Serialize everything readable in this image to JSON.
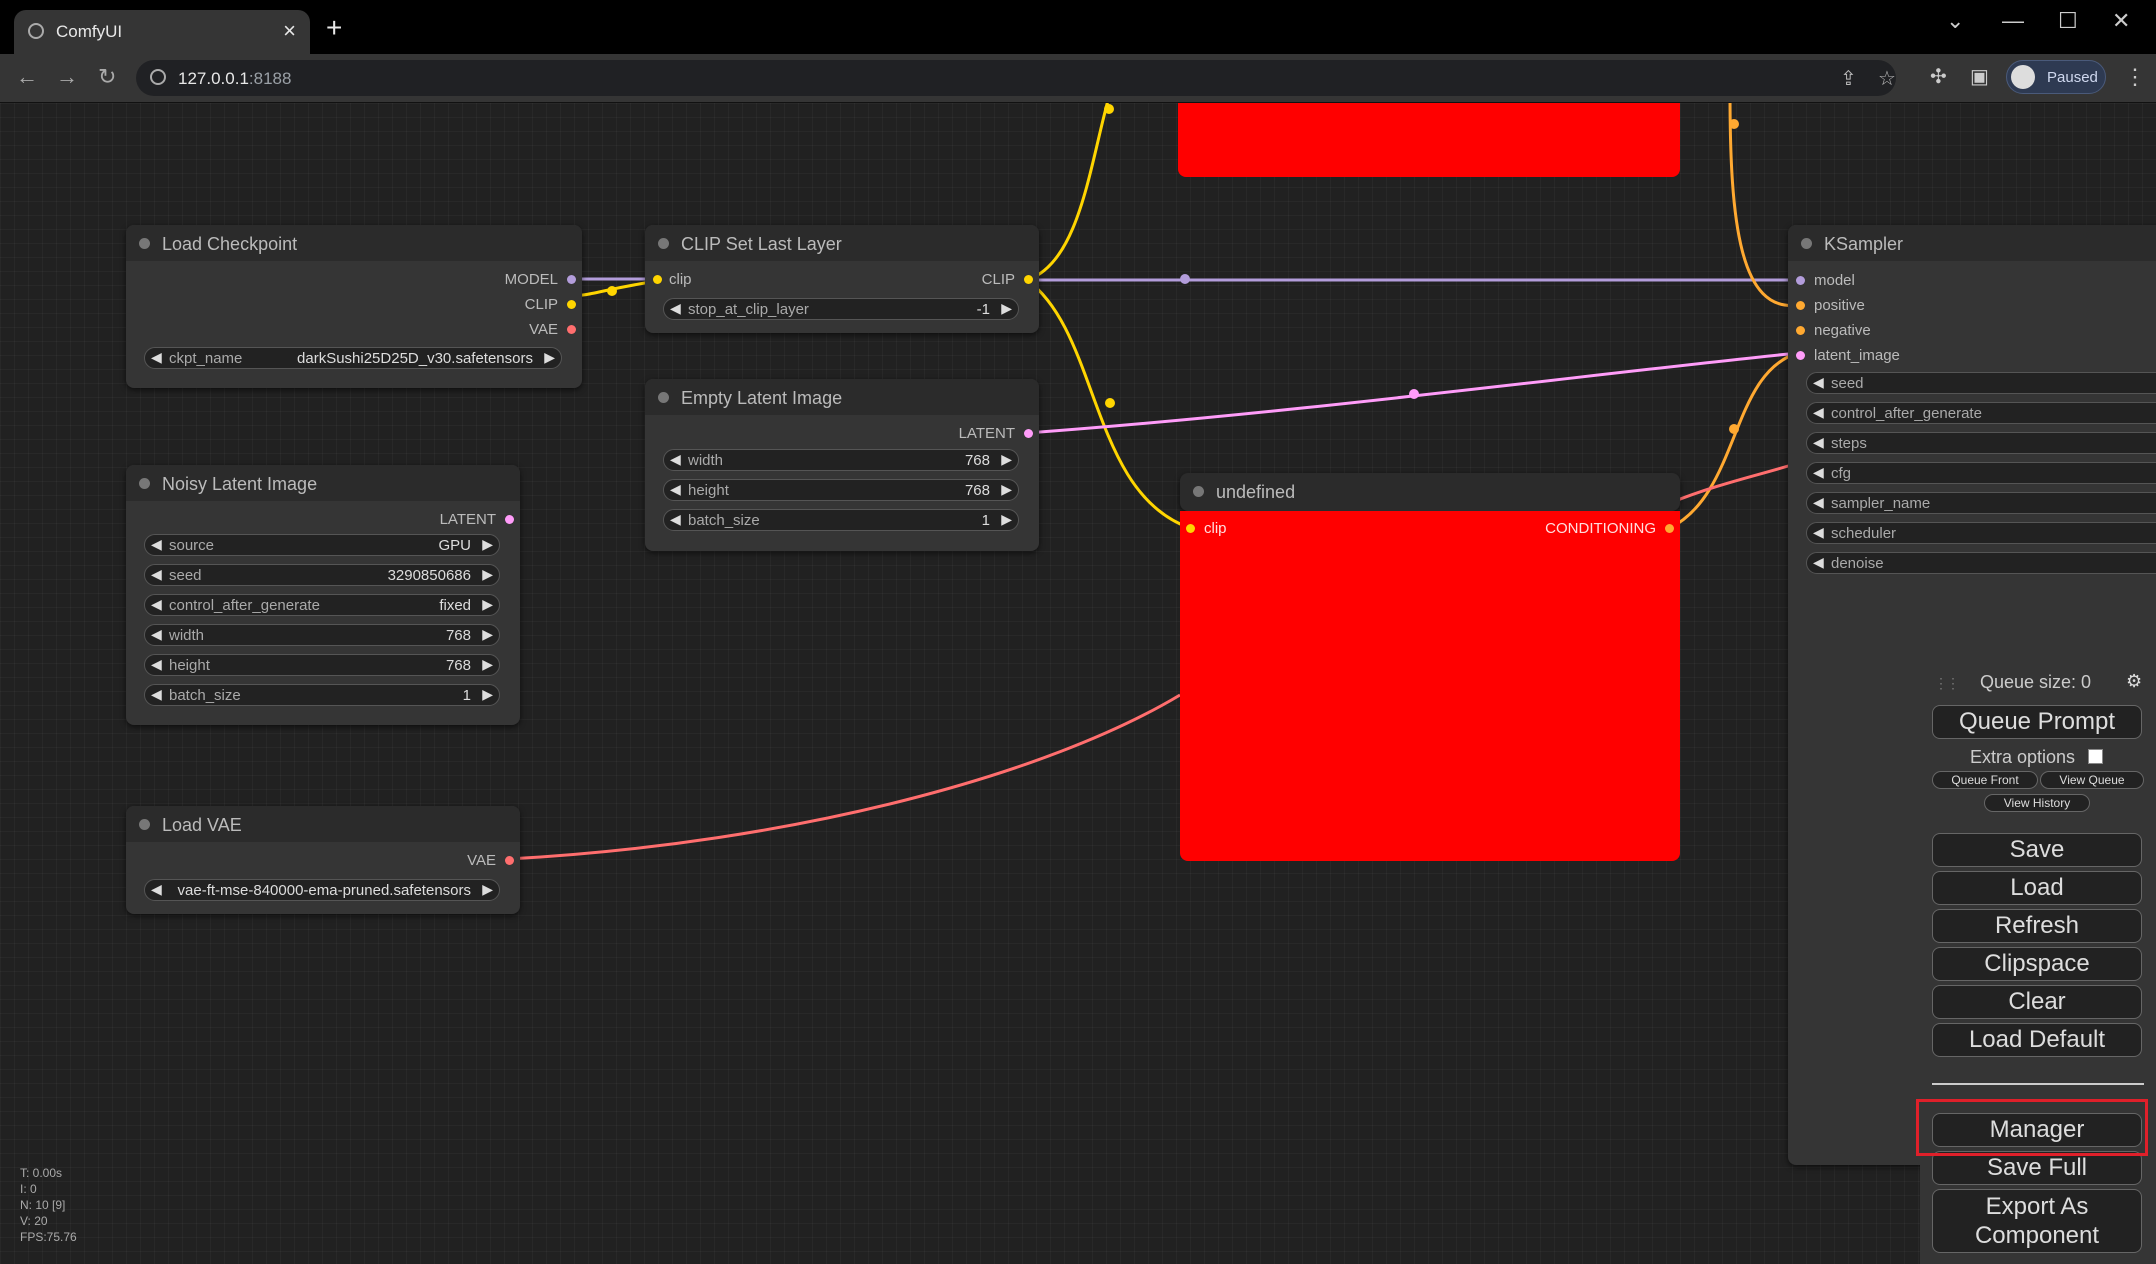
{
  "browser": {
    "tab_title": "ComfyUI",
    "url_host": "127.0.0.1",
    "url_port": ":8188",
    "profile_label": "Paused"
  },
  "nodes": {
    "load_checkpoint": {
      "title": "Load Checkpoint",
      "outputs": [
        "MODEL",
        "CLIP",
        "VAE"
      ],
      "ckpt_label": "ckpt_name",
      "ckpt_value": "darkSushi25D25D_v30.safetensors"
    },
    "clip_set_last_layer": {
      "title": "CLIP Set Last Layer",
      "input": "clip",
      "output": "CLIP",
      "widget_label": "stop_at_clip_layer",
      "widget_value": "-1"
    },
    "empty_latent": {
      "title": "Empty Latent Image",
      "output": "LATENT",
      "widgets": [
        {
          "label": "width",
          "value": "768"
        },
        {
          "label": "height",
          "value": "768"
        },
        {
          "label": "batch_size",
          "value": "1"
        }
      ]
    },
    "noisy_latent": {
      "title": "Noisy Latent Image",
      "output": "LATENT",
      "widgets": [
        {
          "label": "source",
          "value": "GPU"
        },
        {
          "label": "seed",
          "value": "3290850686"
        },
        {
          "label": "control_after_generate",
          "value": "fixed"
        },
        {
          "label": "width",
          "value": "768"
        },
        {
          "label": "height",
          "value": "768"
        },
        {
          "label": "batch_size",
          "value": "1"
        }
      ]
    },
    "load_vae": {
      "title": "Load VAE",
      "output": "VAE",
      "widget_value": "vae-ft-mse-840000-ema-pruned.safetensors"
    },
    "undefined_node": {
      "title": "undefined",
      "input": "clip",
      "output": "CONDITIONING"
    },
    "ksampler": {
      "title": "KSampler",
      "inputs": [
        "model",
        "positive",
        "negative",
        "latent_image"
      ],
      "widgets": [
        "seed",
        "control_after_generate",
        "steps",
        "cfg",
        "sampler_name",
        "scheduler",
        "denoise"
      ]
    }
  },
  "menu": {
    "queue_size": "Queue size: 0",
    "queue_prompt": "Queue Prompt",
    "extra_options": "Extra options",
    "queue_front": "Queue Front",
    "view_queue": "View Queue",
    "view_history": "View History",
    "save": "Save",
    "load": "Load",
    "refresh": "Refresh",
    "clipspace": "Clipspace",
    "clear": "Clear",
    "load_default": "Load Default",
    "manager": "Manager",
    "save_full": "Save Full",
    "export_component": "Export As Component"
  },
  "stats": {
    "t": "T: 0.00s",
    "i": "I: 0",
    "n": "N: 10 [9]",
    "v": "V: 20",
    "fps": "FPS:75.76"
  },
  "colors": {
    "clip": "#ffd500",
    "model": "#b39ddb",
    "latent": "#ff9cf9",
    "vae": "#ff6e6e",
    "conditioning": "#ffa931",
    "red_node": "#ff0000",
    "highlight": "#e0202a"
  }
}
